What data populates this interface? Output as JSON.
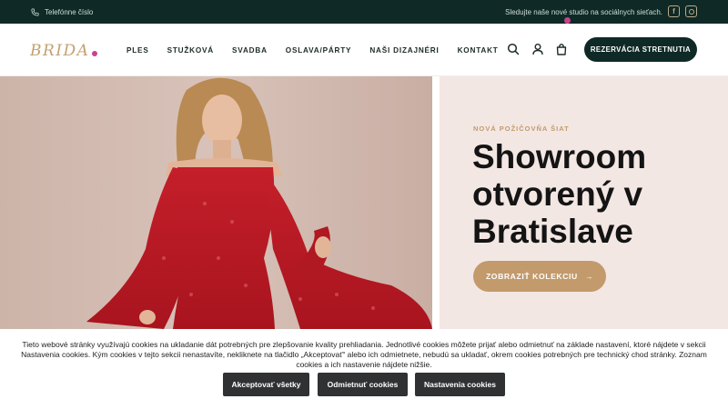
{
  "topbar": {
    "phone_label": "Telefónne číslo",
    "follow_text": "Sledujte naše nové studio na sociálnych sieťach.",
    "social": [
      "facebook-icon",
      "instagram-icon"
    ]
  },
  "header": {
    "logo_text": "BRIDA.",
    "nav": [
      "PLES",
      "STUŽKOVÁ",
      "SVADBA",
      "OSLAVA/PÁRTY",
      "NAŠI DIZAJNÉRI",
      "KONTAKT"
    ],
    "cta_label": "REZERVÁCIA STRETNUTIA",
    "icons": [
      "search-icon",
      "user-icon",
      "cart-icon"
    ]
  },
  "hero": {
    "eyebrow": "NOVÁ POŽIČOVŇA ŠIAT",
    "headline": "Showroom otvorený v Bratislave",
    "button_label": "ZOBRAZIŤ KOLEKCIU",
    "button_arrow": "→"
  },
  "cookie": {
    "text": "Tieto webové stránky využívajú cookies na ukladanie dát potrebných pre zlepšovanie kvality prehliadania. Jednotlivé cookies môžete prijať alebo odmietnuť na základe nastavení, ktoré nájdete v sekcii Nastavenia cookies. Kým cookies v tejto sekcii nenastavíte, nekliknete na tlačidlo „Akceptovať“ alebo ich odmietnete, nebudú sa ukladať, okrem cookies potrebných pre technický chod stránky. Zoznam cookies a ich nastavenie nájdete nižšie.",
    "accept_label": "Akceptovať všetky",
    "reject_label": "Odmietnuť cookies",
    "settings_label": "Nastavenia cookies"
  },
  "colors": {
    "dark": "#0f2a26",
    "gold": "#c39a6c",
    "panel": "#f3e7e4",
    "badge": "#c9428a"
  }
}
